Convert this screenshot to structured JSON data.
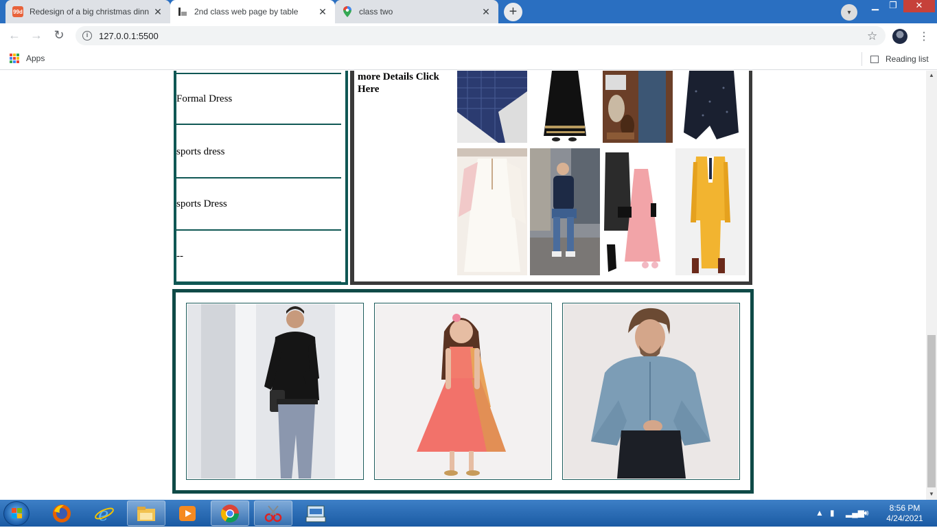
{
  "browser": {
    "tabs": [
      {
        "title": "Redesign of a big christmas dinn",
        "favicon": "99d-icon",
        "active": false
      },
      {
        "title": "2nd class web page by table",
        "favicon": "page-logo-icon",
        "active": true
      },
      {
        "title": "class two",
        "favicon": "maps-pin-icon",
        "active": false
      }
    ],
    "url": "127.0.0.1:5500",
    "bookmarks": {
      "apps_label": "Apps",
      "reading_list_label": "Reading list"
    },
    "colors": {
      "titlebar": "#2a6fc1",
      "accent_teal": "#0f5754"
    }
  },
  "page": {
    "categories": [
      "Formal Dress",
      "sports dress",
      "sports Dress",
      "--"
    ],
    "details_link": "more Details Click Here",
    "gallery": [
      [
        "navy-check-shirt-image",
        "black-abaya-image",
        "shoes-and-jeans-image",
        "black-sheer-top-image"
      ],
      [
        "white-embroidered-dress-image",
        "man-sitting-street-image",
        "pink-dress-outfit-image",
        "yellow-suit-image"
      ]
    ],
    "featured": [
      {
        "name": "man-black-shirt-photo"
      },
      {
        "name": "girl-coral-dress-photo"
      },
      {
        "name": "man-denim-shirt-photo"
      }
    ]
  },
  "taskbar": {
    "apps": [
      "firefox-icon",
      "internet-explorer-icon",
      "file-explorer-icon",
      "media-player-icon",
      "chrome-icon",
      "snipping-tool-icon",
      "keyboard-icon"
    ],
    "time": "8:56 PM",
    "date": "4/24/2021"
  }
}
